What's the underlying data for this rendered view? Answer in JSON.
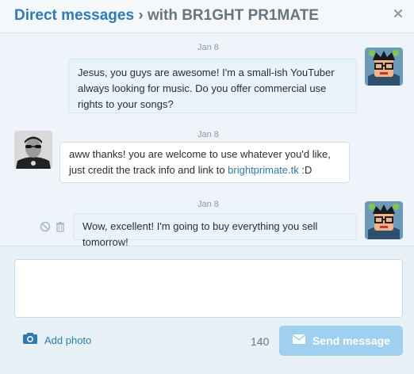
{
  "header": {
    "title_primary": "Direct messages",
    "separator": "›",
    "title_secondary": "with BR1GHT PR1MATE",
    "close_icon": "close-icon"
  },
  "messages": [
    {
      "date": "Jan 8",
      "direction": "sent",
      "text": "Jesus, you guys are awesome! I'm a small-ish YouTuber always looking for music. Do you offer commercial use rights to your songs?",
      "avatar": "cartoon-avatar"
    },
    {
      "date": "Jan 8",
      "direction": "received",
      "text_before_link": "aww thanks! you are welcome to use whatever you'd like, just credit the track info and link to ",
      "link": "brightprimate.tk",
      "text_after_link": " :D",
      "avatar": "photo-avatar"
    },
    {
      "date": "Jan 8",
      "direction": "sent",
      "text": "Wow, excellent! I'm going to buy everything you sell tomorrow!",
      "avatar": "cartoon-avatar",
      "actions": [
        "block-icon",
        "trash-icon"
      ]
    }
  ],
  "composer": {
    "value": "",
    "add_photo_label": "Add photo",
    "camera_icon": "camera-icon",
    "char_count": "140",
    "send_label": "Send message",
    "send_icon": "envelope-icon"
  },
  "colors": {
    "accent": "#2b7bb9",
    "send_button_disabled": "#9fd0f0",
    "conversation_bg": "#eef4f9"
  }
}
